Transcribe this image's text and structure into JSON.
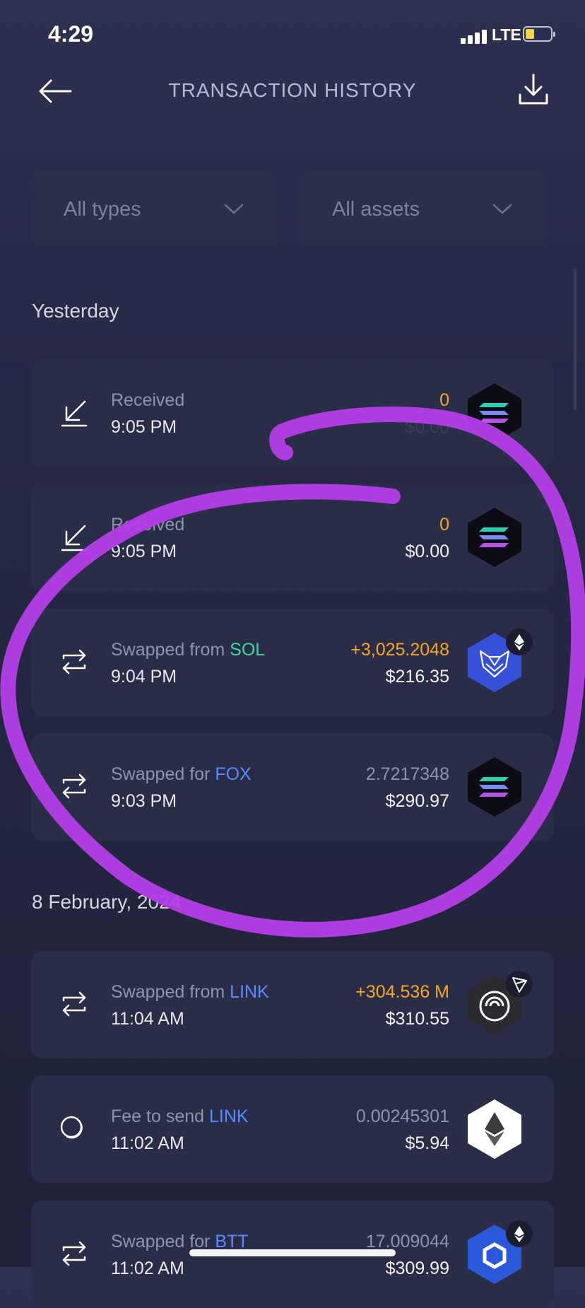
{
  "status": {
    "time": "4:29",
    "network": "LTE"
  },
  "header": {
    "title": "TRANSACTION HISTORY"
  },
  "filters": {
    "types": "All types",
    "assets": "All assets"
  },
  "sections": [
    {
      "title": "Yesterday",
      "items": [
        {
          "type": "Received",
          "asset": "",
          "time": "9:05 PM",
          "amount": "0",
          "usd": "$0.00",
          "token_icon": "solana-icon"
        },
        {
          "type": "Received",
          "asset": "",
          "time": "9:05 PM",
          "amount": "0",
          "usd": "$0.00",
          "token_icon": "solana-icon"
        },
        {
          "type": "Swapped from ",
          "asset": "SOL",
          "time": "9:04 PM",
          "amount": "+3,025.2048",
          "usd": "$216.35",
          "token_icon": "shapeshift-fox-icon"
        },
        {
          "type": "Swapped for ",
          "asset": "FOX",
          "time": "9:03 PM",
          "amount": "2.7217348",
          "usd": "$290.97",
          "token_icon": "solana-icon"
        }
      ]
    },
    {
      "title": "8 February, 2024",
      "items": [
        {
          "type": "Swapped from ",
          "asset": "LINK",
          "time": "11:04 AM",
          "amount": "+304.536 M",
          "usd": "$310.55",
          "token_icon": "bittorrent-icon"
        },
        {
          "type": "Fee to send ",
          "asset": "LINK",
          "time": "11:02 AM",
          "amount": "0.00245301",
          "usd": "$5.94",
          "token_icon": "ethereum-icon"
        },
        {
          "type": "Swapped for ",
          "asset": "BTT",
          "time": "11:02 AM",
          "amount": "17.009044",
          "usd": "$309.99",
          "token_icon": "chainlink-icon"
        }
      ]
    }
  ],
  "colors": {
    "accent_orange": "#f5a623",
    "sol_green": "#3fd6a3",
    "link_blue": "#5a8cff",
    "annotation_purple": "#b43ee8"
  }
}
